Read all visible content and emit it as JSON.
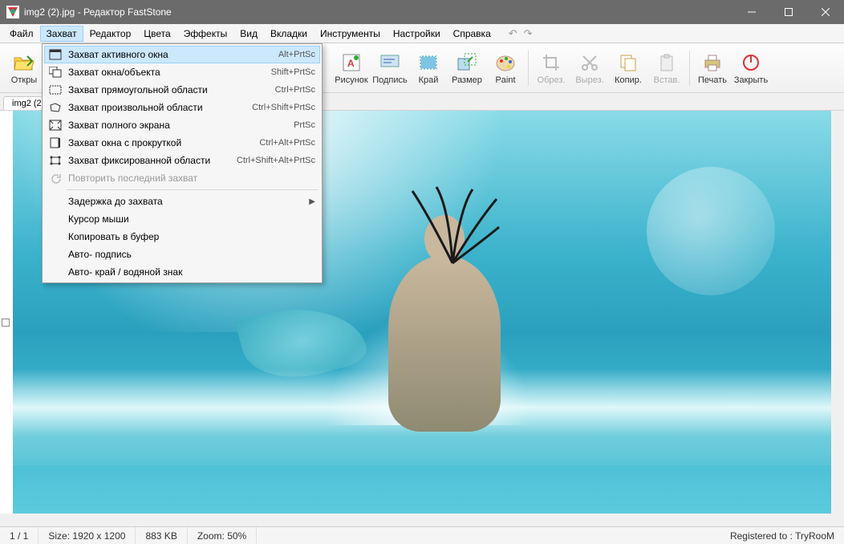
{
  "titlebar": {
    "title": "img2 (2).jpg - Редактор FastStone"
  },
  "menubar": {
    "items": [
      "Файл",
      "Захват",
      "Редактор",
      "Цвета",
      "Эффекты",
      "Вид",
      "Вкладки",
      "Инструменты",
      "Настройки",
      "Справка"
    ],
    "active_index": 1
  },
  "toolbar": {
    "open": "Откры",
    "draw": "Рисунок",
    "caption": "Подпись",
    "edge": "Край",
    "resize": "Размер",
    "paint": "Paint",
    "crop": "Обрез.",
    "cut": "Вырез.",
    "copy": "Копир.",
    "paste": "Встав.",
    "print": "Печать",
    "close": "Закрыть"
  },
  "tab": {
    "label": "img2 (2"
  },
  "dropdown": {
    "items": [
      {
        "label": "Захват активного окна",
        "shortcut": "Alt+PrtSc",
        "icon": "window"
      },
      {
        "label": "Захват окна/объекта",
        "shortcut": "Shift+PrtSc",
        "icon": "object"
      },
      {
        "label": "Захват прямоугольной области",
        "shortcut": "Ctrl+PrtSc",
        "icon": "rect"
      },
      {
        "label": "Захват произвольной области",
        "shortcut": "Ctrl+Shift+PrtSc",
        "icon": "freeform"
      },
      {
        "label": "Захват полного экрана",
        "shortcut": "PrtSc",
        "icon": "fullscreen"
      },
      {
        "label": "Захват окна с прокруткой",
        "shortcut": "Ctrl+Alt+PrtSc",
        "icon": "scroll"
      },
      {
        "label": "Захват фиксированной области",
        "shortcut": "Ctrl+Shift+Alt+PrtSc",
        "icon": "fixed"
      },
      {
        "label": "Повторить последний захват",
        "shortcut": "",
        "icon": "repeat",
        "disabled": true
      },
      {
        "sep": true
      },
      {
        "label": "Задержка до захвата",
        "submenu": true
      },
      {
        "label": "Курсор мыши"
      },
      {
        "label": "Копировать в буфер"
      },
      {
        "label": "Авто- подпись"
      },
      {
        "label": "Авто- край / водяной знак"
      }
    ]
  },
  "status": {
    "page": "1 / 1",
    "size_label": "Size:",
    "size_value": "1920 x 1200",
    "filesize": "883 KB",
    "zoom_label": "Zoom:",
    "zoom_value": "50%",
    "registered": "Registered to : TryRooM"
  }
}
